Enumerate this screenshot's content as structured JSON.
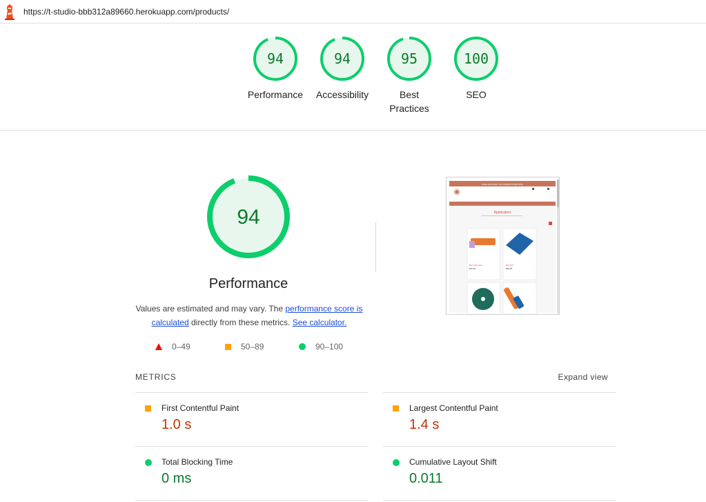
{
  "url": "https://t-studio-bbb312a89660.herokuapp.com/products/",
  "colors": {
    "pass": "#0cce6b",
    "pass_text": "#0a7a2a",
    "average": "#ffa400",
    "average_text": "#c33300",
    "fail": "#eb0f00",
    "link": "#1a4ed8"
  },
  "categories": [
    {
      "label": "Performance",
      "score": "94",
      "value": 94
    },
    {
      "label": "Accessibility",
      "score": "94",
      "value": 94
    },
    {
      "label": "Best Practices",
      "score": "95",
      "value": 95
    },
    {
      "label": "SEO",
      "score": "100",
      "value": 100
    }
  ],
  "performance": {
    "score": "94",
    "value": 94,
    "title": "Performance",
    "desc_part1": "Values are estimated and may vary. The ",
    "link1": "performance score is calculated",
    "desc_part2": " directly from these metrics. ",
    "link2": "See calculator."
  },
  "legend": [
    {
      "shape": "triangle",
      "range": "0–49"
    },
    {
      "shape": "square",
      "range": "50–89"
    },
    {
      "shape": "circle",
      "range": "90–100"
    }
  ],
  "thumbnail": {
    "banner": "FREE DELIVERY ON ORDERS OVER €150",
    "heading": "Applicators",
    "products": [
      {
        "name": "Bolt Little One",
        "price": "€25.00"
      },
      {
        "name": "Big Pad",
        "price": "€80.00"
      }
    ]
  },
  "metrics": {
    "title": "METRICS",
    "expand_label": "Expand view",
    "items": [
      {
        "name": "First Contentful Paint",
        "value": "1.0 s",
        "status": "average"
      },
      {
        "name": "Largest Contentful Paint",
        "value": "1.4 s",
        "status": "average"
      },
      {
        "name": "Total Blocking Time",
        "value": "0 ms",
        "status": "pass"
      },
      {
        "name": "Cumulative Layout Shift",
        "value": "0.011",
        "status": "pass"
      }
    ]
  }
}
